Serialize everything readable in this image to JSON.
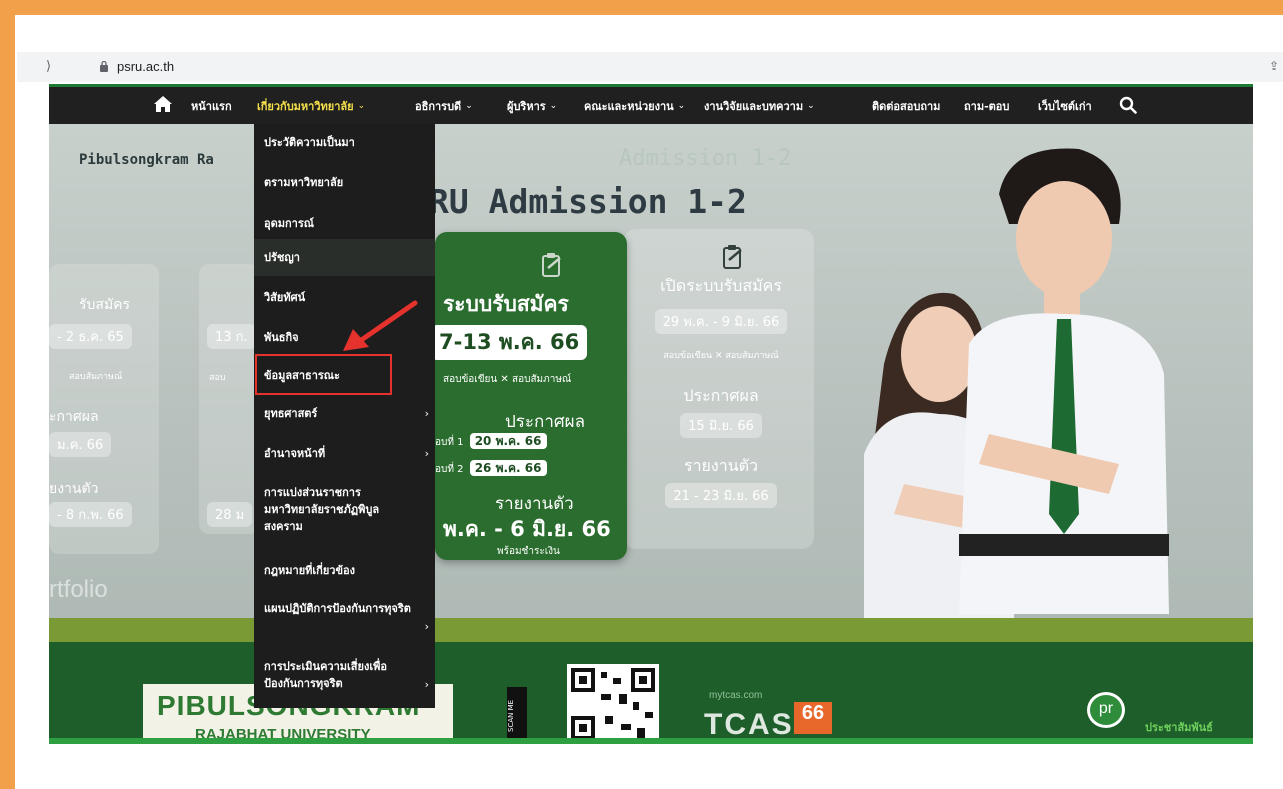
{
  "browser": {
    "url": "psru.ac.th"
  },
  "nav": {
    "items": [
      {
        "label": "หน้าแรก",
        "chevron": false
      },
      {
        "label": "เกี่ยวกับมหาวิทยาลัย",
        "chevron": true
      },
      {
        "label": "อธิการบดี",
        "chevron": true
      },
      {
        "label": "ผู้บริหาร",
        "chevron": true
      },
      {
        "label": "คณะและหน่วยงาน",
        "chevron": true
      },
      {
        "label": "งานวิจัยและบทความ",
        "chevron": true
      },
      {
        "label": "ติดต่อสอบถาม",
        "chevron": false
      },
      {
        "label": "ถาม-ตอบ",
        "chevron": false
      },
      {
        "label": "เว็บไซต์เก่า",
        "chevron": false
      }
    ],
    "chevron_glyph": "⌄"
  },
  "dropdown": {
    "items": [
      {
        "label": "ประวัติความเป็นมา"
      },
      {
        "label": "ตรามหาวิทยาลัย"
      },
      {
        "label": "อุดมการณ์"
      },
      {
        "label": "ปรัชญา"
      },
      {
        "label": "วิสัยทัศน์"
      },
      {
        "label": "พันธกิจ"
      },
      {
        "label": "ข้อมูลสาธารณะ"
      },
      {
        "label": "ยุทธศาสตร์",
        "submenu": true
      },
      {
        "label": "อำนาจหน้าที่",
        "submenu": true
      },
      {
        "label": "การแบ่งส่วนราชการ มหาวิทยาลัยราชภัฏพิบูลสงคราม"
      },
      {
        "label": "กฎหมายที่เกี่ยวข้อง"
      },
      {
        "label": "แผนปฏิบัติการป้องกันการทุจริต",
        "submenu": true
      },
      {
        "label": "การประเมินความเสี่ยงเพื่อป้องกันการทุจริต",
        "submenu": true
      }
    ],
    "submenu_glyph": "›",
    "highlighted_item": "ข้อมูลสาธารณะ"
  },
  "hero": {
    "site_title": "Pibulsongkram Ra",
    "admission_ghost": "Admission 1-2",
    "admission_prefix": "RU",
    "admission_main": "Admission 1-2",
    "left_faded": {
      "register": "รับสมัคร",
      "date1": "- 2 ธ.ค. 65",
      "exam": "สอบสัมภาษณ์",
      "announce": "ะกาศผล",
      "date2": "ม.ค. 66",
      "report": "ยงานตัว",
      "date3": "- 8 ก.พ. 66",
      "portfolio": "rtfolio"
    },
    "mid_faded": {
      "date1": "13 ก.",
      "exam": "สอบ",
      "date2": "28 ม"
    },
    "green_card": {
      "title": "ระบบรับสมัคร",
      "date": "7-13 พ.ค. 66",
      "exam_line": "สอบข้อเขียน ✕ สอบสัมภาษณ์",
      "announce": "ประกาศผล",
      "round1_label": "อบที่ 1",
      "round1_date": "20 พ.ค. 66",
      "round2_label": "อบที่ 2",
      "round2_date": "26 พ.ค. 66",
      "report": "รายงานตัว",
      "report_date": "พ.ค. - 6 มิ.ย. 66",
      "pay": "พร้อมชำระเงิน"
    },
    "right_card": {
      "title": "เปิดระบบรับสมัคร",
      "date": "29 พ.ค. - 9 มิ.ย. 66",
      "exam": "สอบข้อเขียน ✕ สอบสัมภาษณ์",
      "announce": "ประกาศผล",
      "announce_date": "15 มิ.ย. 66",
      "report": "รายงานตัว",
      "report_date": "21 - 23 มิ.ย. 66"
    },
    "bottom": {
      "logo_line1": "PIBULSONGKRAM",
      "logo_line2": "RAJABHAT UNIVERSITY",
      "scan_me": "SCAN ME",
      "tcas_site": "mytcas.com",
      "tcas": "TCAS",
      "tcas_num": "66",
      "pr": "pr",
      "pr_text": "ประชาสัมพันธ์"
    }
  },
  "annotation": {
    "highlight_color": "#e5322d"
  }
}
